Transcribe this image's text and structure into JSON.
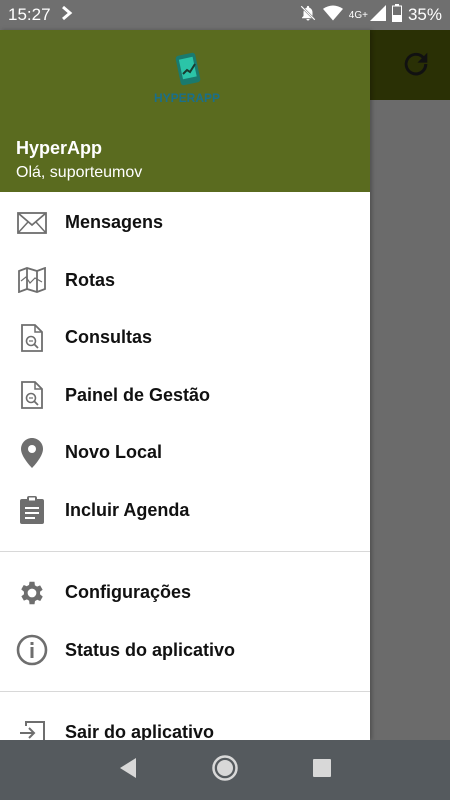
{
  "status_bar": {
    "time": "15:27",
    "network": "4G+",
    "battery": "35%"
  },
  "drawer": {
    "logo_text": "HYPERAPP",
    "title": "HyperApp",
    "greeting": "Olá, suporteumov",
    "menu_primary": [
      {
        "label": "Mensagens",
        "icon": "mail-icon"
      },
      {
        "label": "Rotas",
        "icon": "map-icon"
      },
      {
        "label": "Consultas",
        "icon": "document-search-icon"
      },
      {
        "label": "Painel de Gestão",
        "icon": "document-search-icon"
      },
      {
        "label": "Novo Local",
        "icon": "location-pin-icon"
      },
      {
        "label": "Incluir Agenda",
        "icon": "clipboard-icon"
      }
    ],
    "menu_secondary": [
      {
        "label": "Configurações",
        "icon": "gear-icon"
      },
      {
        "label": "Status do aplicativo",
        "icon": "info-icon"
      }
    ],
    "menu_tertiary": [
      {
        "label": "Sair do aplicativo",
        "icon": "exit-icon"
      }
    ]
  },
  "colors": {
    "header_green": "#5a6b1f",
    "toolbar_dark": "#2a3005",
    "icon_gray": "#6e6e6e"
  }
}
